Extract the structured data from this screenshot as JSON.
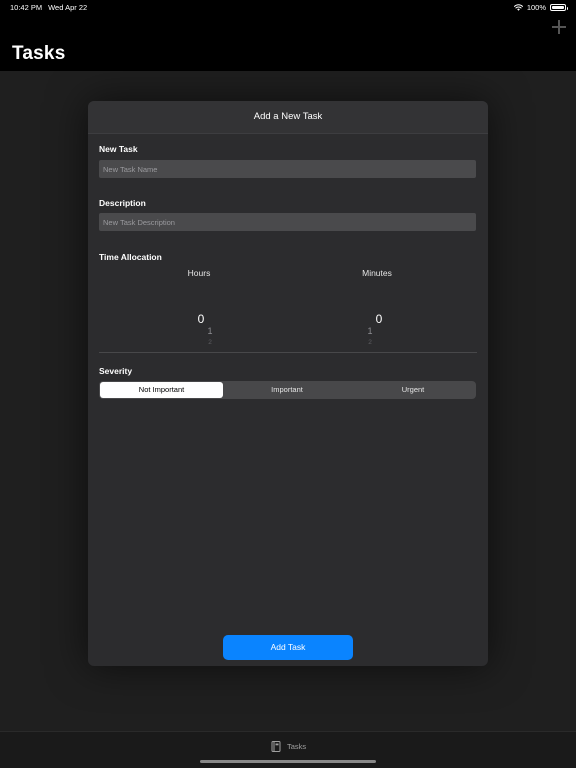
{
  "status_bar": {
    "time": "10:42 PM",
    "date": "Wed Apr 22",
    "battery_text": "100%",
    "battery_level": 1.0
  },
  "nav": {
    "title": "Tasks",
    "add_icon": "plus-icon"
  },
  "sheet": {
    "title": "Add a New Task",
    "new_task": {
      "label": "New Task",
      "value": "",
      "placeholder": "New Task Name"
    },
    "description": {
      "label": "Description",
      "value": "",
      "placeholder": "New Task Description"
    },
    "time_allocation": {
      "label": "Time Allocation",
      "hours": {
        "header": "Hours",
        "selected": "0",
        "next": "1",
        "next2": "2"
      },
      "minutes": {
        "header": "Minutes",
        "selected": "0",
        "next": "1",
        "next2": "2"
      }
    },
    "severity": {
      "label": "Severity",
      "options": [
        "Not Important",
        "Important",
        "Urgent"
      ],
      "selected": "Not Important"
    },
    "submit_label": "Add Task"
  },
  "tab_bar": {
    "items": [
      {
        "label": "Tasks",
        "icon": "book-icon"
      }
    ]
  },
  "colors": {
    "accent": "#0a84ff",
    "sheet_bg": "#2c2c2e",
    "field_bg": "#4a4a4c"
  }
}
